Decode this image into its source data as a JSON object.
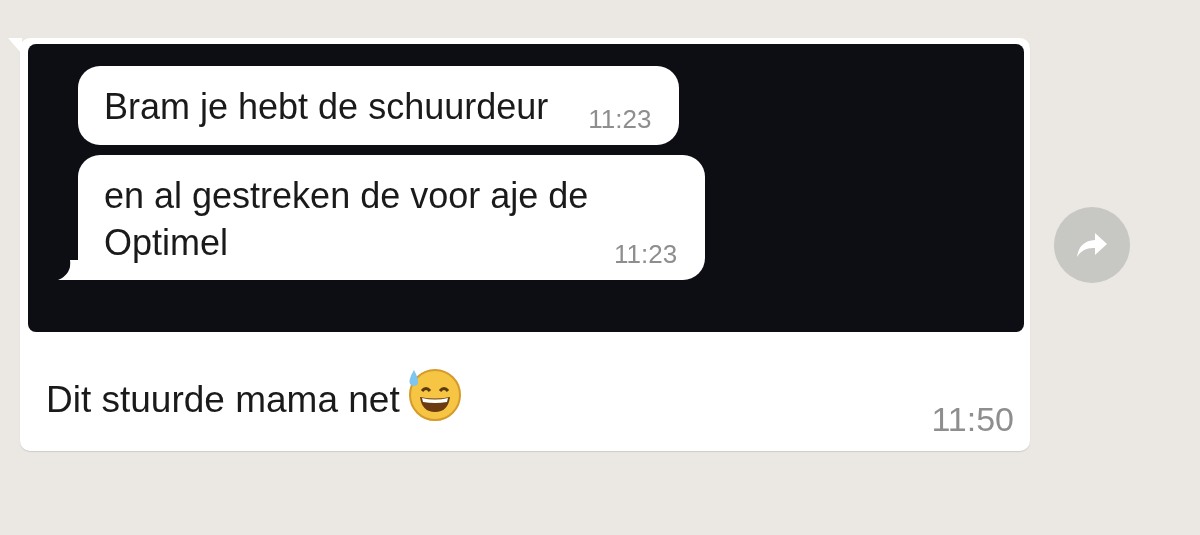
{
  "message": {
    "screenshot": {
      "messages": [
        {
          "text": "Bram je hebt de schuurdeur",
          "time": "11:23",
          "tail": false
        },
        {
          "text": "en al gestreken de voor aje de Optimel",
          "time": "11:23",
          "tail": true
        }
      ]
    },
    "caption": "Dit stuurde mama net",
    "time": "11:50"
  }
}
